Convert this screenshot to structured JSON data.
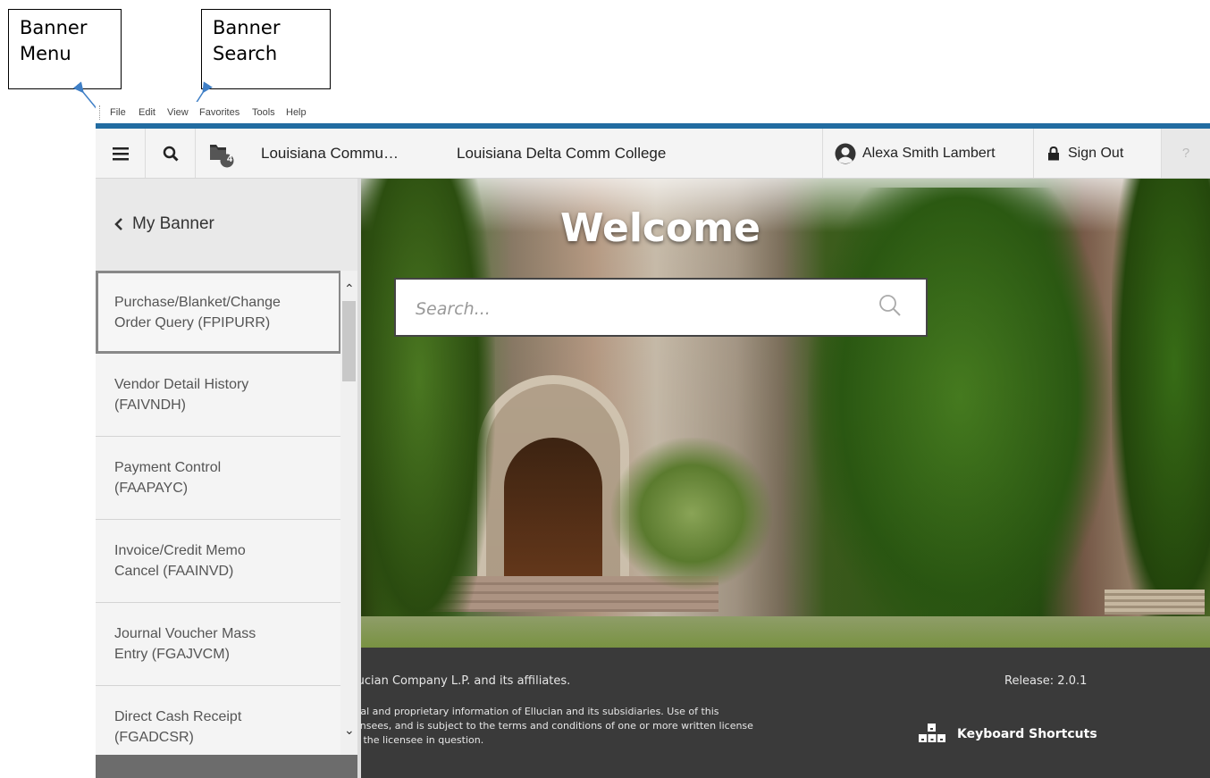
{
  "annotations": {
    "banner_menu": [
      "Banner",
      "Menu"
    ],
    "banner_search": [
      "Banner",
      "Search"
    ]
  },
  "ie_menubar": [
    "File",
    "Edit",
    "View",
    "Favorites",
    "Tools",
    "Help"
  ],
  "header": {
    "recent_count": "4",
    "institution_1": "Louisiana Commu…",
    "institution_2": "Louisiana Delta Comm College",
    "user": "Alexa Smith Lambert",
    "sign_out": "Sign Out",
    "help": "?"
  },
  "sidebar": {
    "back_label": "My Banner",
    "items": [
      [
        "Purchase/Blanket/Change",
        "Order Query (FPIPURR)"
      ],
      [
        "Vendor Detail History",
        "(FAIVNDH)"
      ],
      [
        "Payment Control",
        "(FAAPAYC)"
      ],
      [
        "Invoice/Credit Memo",
        "Cancel (FAAINVD)"
      ],
      [
        "Journal Voucher Mass",
        "Entry (FGAJVCM)"
      ],
      [
        "Direct Cash Receipt",
        "(FGADCSR)"
      ]
    ]
  },
  "main": {
    "welcome": "Welcome",
    "search_placeholder": "Search..."
  },
  "footer": {
    "copyright": "lucian Company L.P. and its affiliates.",
    "legal": [
      "tial and proprietary information of Ellucian and its subsidiaries. Use of this",
      "ensees, and is subject to the terms and conditions of one or more written license",
      "d the licensee in question."
    ],
    "release": "Release: 2.0.1",
    "keyboard_shortcuts": "Keyboard Shortcuts"
  },
  "colors": {
    "brand_blue": "#226ca1",
    "footer_bg": "#3a3a3a",
    "header_bg": "#f4f4f4"
  }
}
